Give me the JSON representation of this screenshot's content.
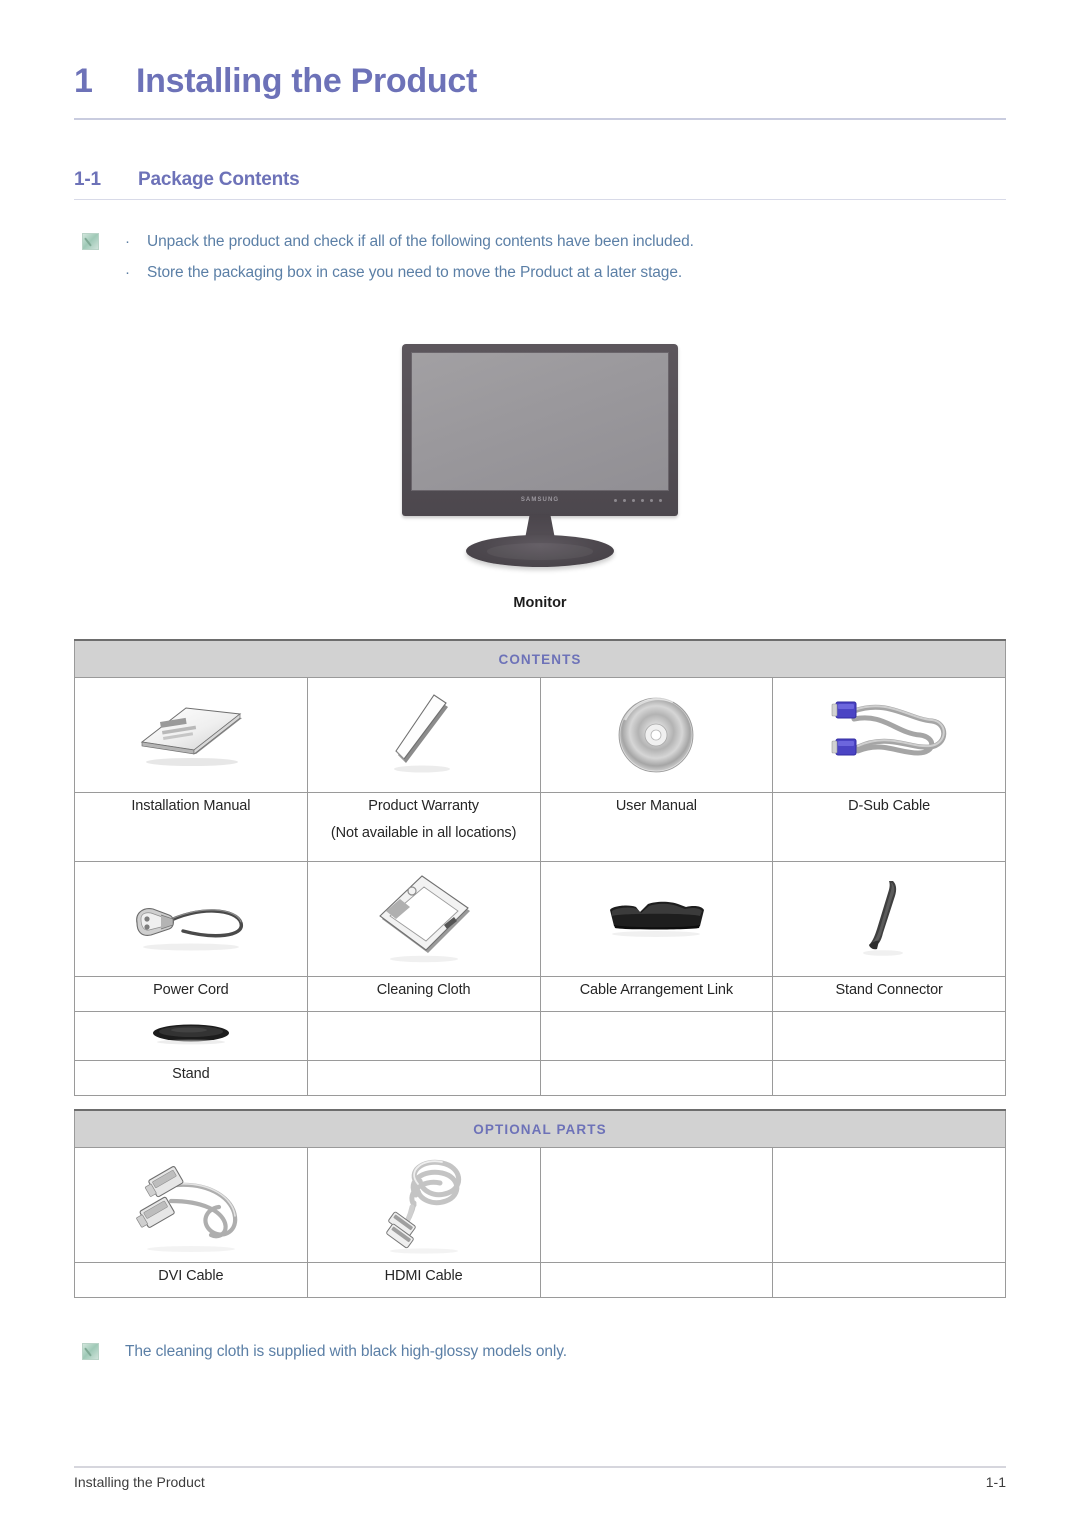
{
  "chapter": {
    "number": "1",
    "title": "Installing the Product"
  },
  "section": {
    "number": "1-1",
    "title": "Package Contents"
  },
  "top_note": {
    "icon": "note-pencil-icon",
    "bullets": [
      "Unpack the product and check if all of the following contents have been included.",
      "Store the packaging box in case you need to move the Product at a later stage."
    ],
    "bullet_char": "·"
  },
  "monitor": {
    "caption": "Monitor",
    "brand_logo": "SAMSUNG"
  },
  "contents_table": {
    "band_label": "CONTENTS",
    "rows": [
      [
        {
          "art": "installation-manual",
          "label": "Installation Manual",
          "sub": ""
        },
        {
          "art": "product-warranty",
          "label": "Product Warranty",
          "sub": "(Not available in all locations)"
        },
        {
          "art": "user-manual-cd",
          "label": "User Manual",
          "sub": ""
        },
        {
          "art": "d-sub-cable",
          "label": "D-Sub Cable",
          "sub": ""
        }
      ],
      [
        {
          "art": "power-cord",
          "label": "Power Cord",
          "sub": ""
        },
        {
          "art": "cleaning-cloth",
          "label": "Cleaning Cloth",
          "sub": ""
        },
        {
          "art": "cable-arrangement-link",
          "label": "Cable Arrangement Link",
          "sub": ""
        },
        {
          "art": "stand-connector",
          "label": "Stand Connector",
          "sub": ""
        }
      ],
      [
        {
          "art": "stand",
          "label": "Stand",
          "sub": ""
        },
        {
          "art": "",
          "label": "",
          "sub": ""
        },
        {
          "art": "",
          "label": "",
          "sub": ""
        },
        {
          "art": "",
          "label": "",
          "sub": ""
        }
      ]
    ]
  },
  "optional_table": {
    "band_label": "OPTIONAL PARTS",
    "rows": [
      [
        {
          "art": "dvi-cable",
          "label": "DVI Cable",
          "sub": ""
        },
        {
          "art": "hdmi-cable",
          "label": "HDMI Cable",
          "sub": ""
        },
        {
          "art": "",
          "label": "",
          "sub": ""
        },
        {
          "art": "",
          "label": "",
          "sub": ""
        }
      ]
    ]
  },
  "bottom_note": {
    "icon": "note-pencil-icon",
    "text": "The cleaning cloth is supplied with black high-glossy models only."
  },
  "footer": {
    "left": "Installing the Product",
    "right": "1-1"
  },
  "colors": {
    "heading": "#6d72b8",
    "note_text": "#5b7fa6",
    "band_bg": "#d2d2d2",
    "table_border": "#8f8f8f"
  }
}
